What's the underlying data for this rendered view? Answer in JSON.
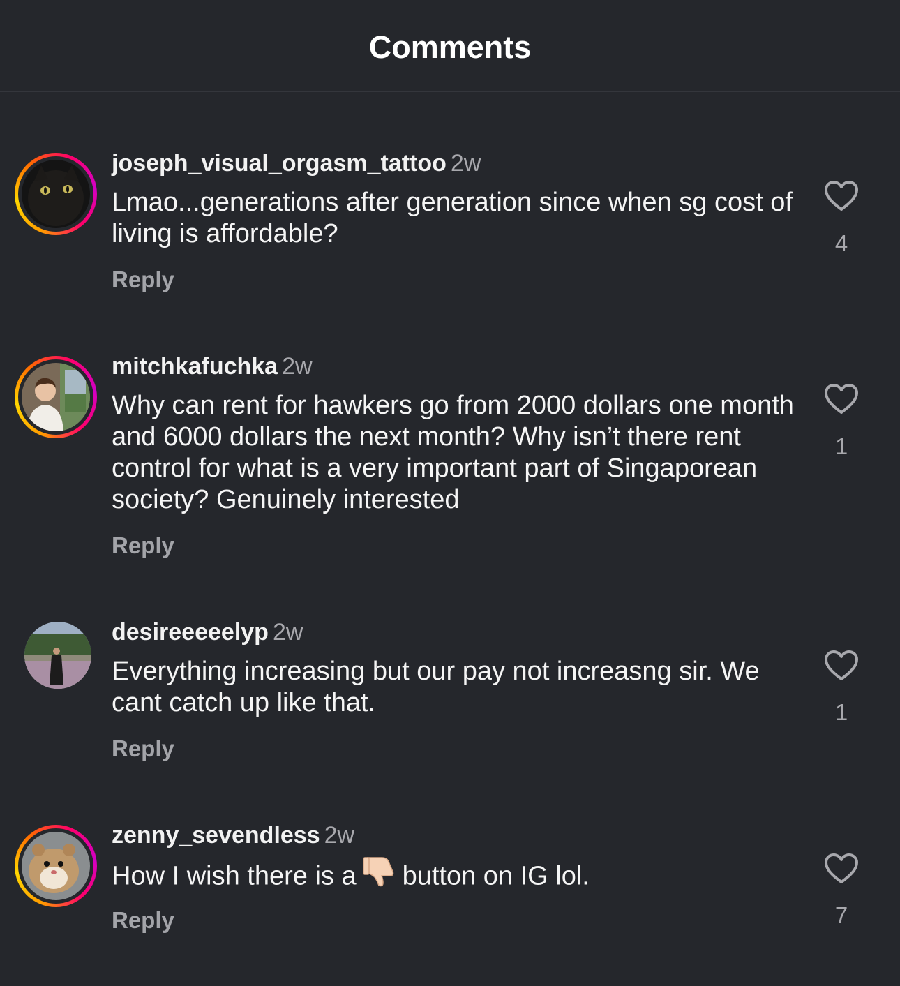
{
  "header": {
    "title": "Comments"
  },
  "comments": [
    {
      "username": "joseph_visual_orgasm_tattoo",
      "time": "2w",
      "text": "Lmao...generations after generation since when sg cost of living is affordable?",
      "reply_label": "Reply",
      "likes": "4",
      "avatar_icon": "black-cat-avatar",
      "has_story_ring": true
    },
    {
      "username": "mitchkafuchka",
      "time": "2w",
      "text": "Why can rent for hawkers go from 2000 dollars one month and 6000 dollars the next month? Why isn’t there rent control for what is a very important part of Singaporean society? Genuinely interested",
      "reply_label": "Reply",
      "likes": "1",
      "avatar_icon": "man-on-train-avatar",
      "has_story_ring": true
    },
    {
      "username": "desireeeeelyp",
      "time": "2w",
      "text": "Everything increasing but our pay not increasng sir. We cant catch up like that.",
      "reply_label": "Reply",
      "likes": "1",
      "avatar_icon": "woman-in-field-avatar",
      "has_story_ring": false
    },
    {
      "username": "zenny_sevendless",
      "time": "2w",
      "text_before": "How I wish there is a",
      "emoji_icon": "thumbs-down-emoji",
      "text_after": "button on IG lol.",
      "reply_label": "Reply",
      "likes": "7",
      "avatar_icon": "hamster-avatar",
      "has_story_ring": true
    }
  ],
  "colors": {
    "background": "#25272c",
    "text": "#f5f5f5",
    "secondary_text": "#a8a8ad",
    "ring_start": "#ffd600",
    "ring_end": "#d300c5"
  }
}
